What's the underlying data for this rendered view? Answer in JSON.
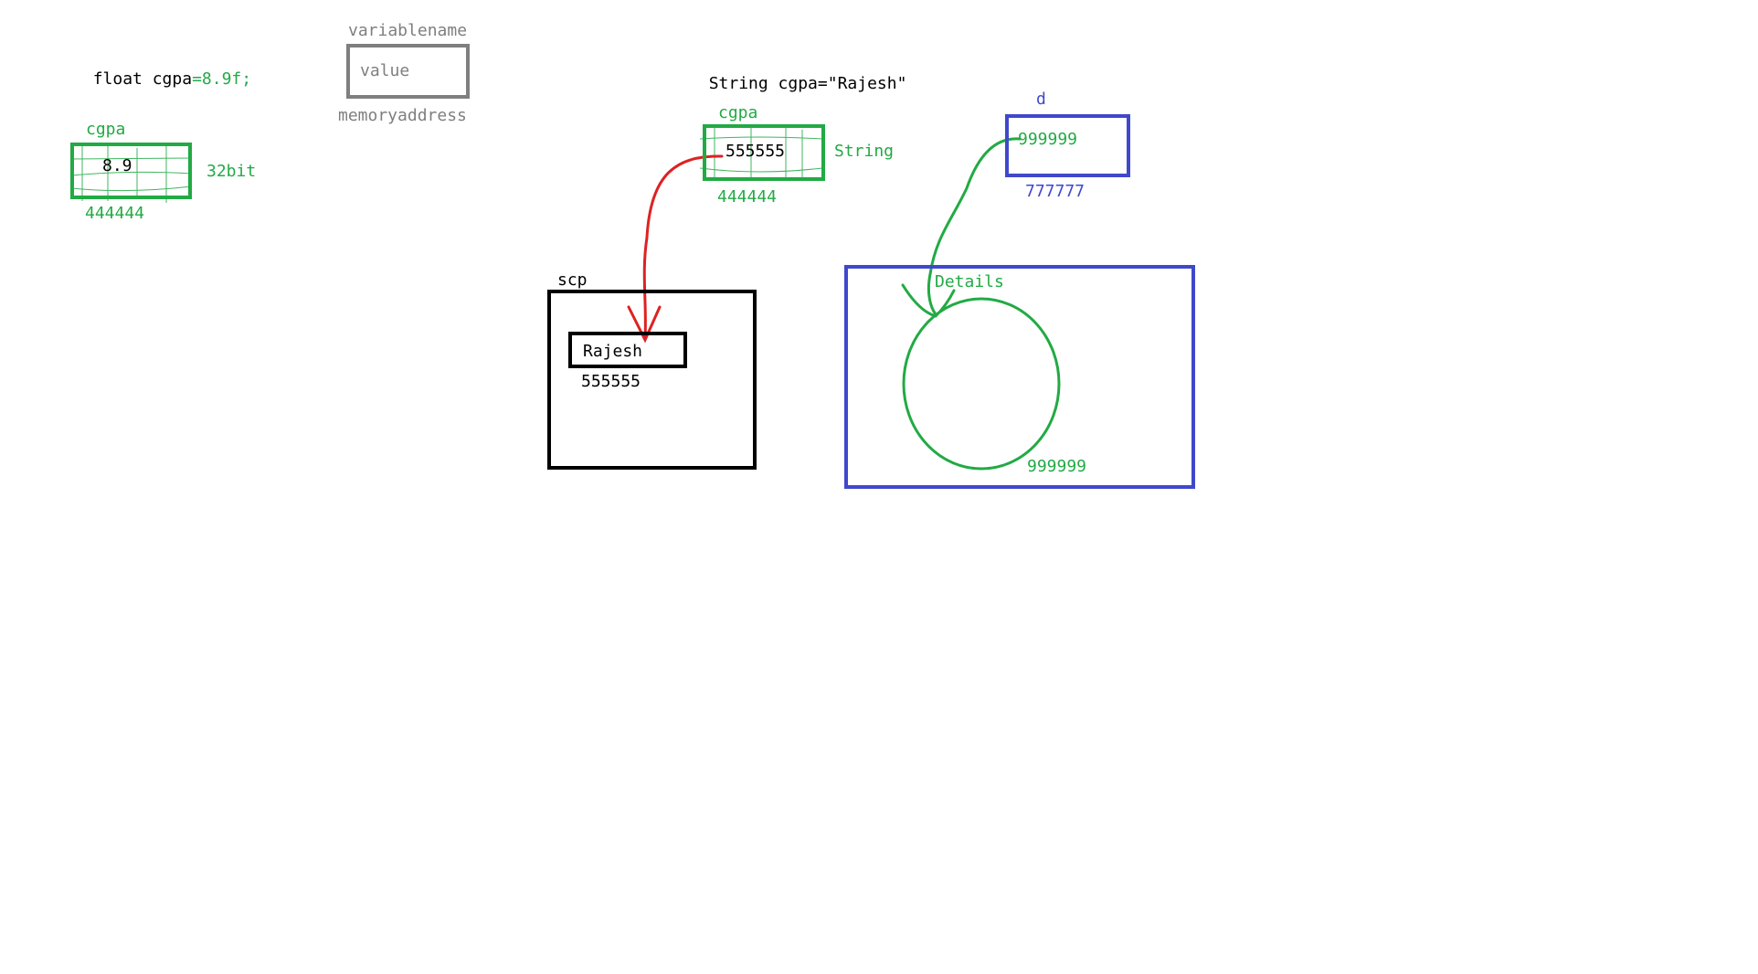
{
  "colors": {
    "green": "#22aa44",
    "blue": "#3f48cc",
    "gray": "#7f7f7f",
    "red": "#dd2222",
    "black": "#000000"
  },
  "legend": {
    "variable_name": "variablename",
    "value": "value",
    "memory_address": "memoryaddress"
  },
  "float_example": {
    "declaration_prefix": "float cgpa",
    "declaration_suffix": "=8.9f;",
    "variable_name": "cgpa",
    "value": "8.9",
    "size": "32bit",
    "address": "444444"
  },
  "string_example": {
    "declaration_prefix": "String cgpa",
    "declaration_suffix": "=\"Rajesh\"",
    "variable_name": "cgpa",
    "value": "555555",
    "type": "String",
    "address": "444444",
    "pool_label": "scp",
    "pool_value": "Rajesh",
    "pool_address": "555555"
  },
  "object_example": {
    "variable_name": "d",
    "value": "999999",
    "address": "777777",
    "heap_label": "Details",
    "object_address": "999999"
  }
}
